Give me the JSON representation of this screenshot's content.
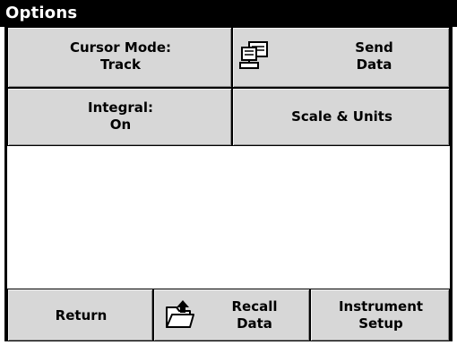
{
  "window": {
    "title": "Options"
  },
  "buttons": {
    "cursor_mode": {
      "line1": "Cursor Mode:",
      "line2": "Track"
    },
    "send_data": {
      "line1": "Send",
      "line2": "Data",
      "icon": "computer-icon"
    },
    "integral": {
      "line1": "Integral:",
      "line2": "On"
    },
    "scale_units": {
      "label": "Scale & Units"
    },
    "return": {
      "label": "Return"
    },
    "recall_data": {
      "line1": "Recall",
      "line2": "Data",
      "icon": "folder-upload-icon"
    },
    "instrument_setup": {
      "line1": "Instrument",
      "line2": "Setup"
    }
  }
}
